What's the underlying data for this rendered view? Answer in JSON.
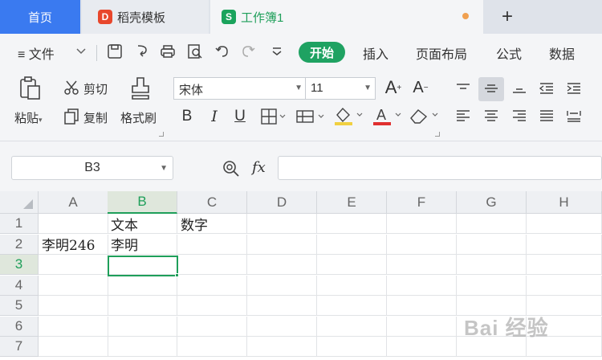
{
  "tabs": {
    "home": "首页",
    "template": "稻壳模板",
    "template_logo": "D",
    "workbook": "工作簿1",
    "workbook_logo": "S",
    "add": "+"
  },
  "menu": {
    "file": "≡ 文件",
    "start": "开始",
    "insert": "插入",
    "page_layout": "页面布局",
    "formula": "公式",
    "data": "数据"
  },
  "ribbon": {
    "paste": "粘贴",
    "cut": "剪切",
    "copy": "复制",
    "format_painter": "格式刷",
    "font_name": "宋体",
    "font_size": "11",
    "bold": "B",
    "italic": "I",
    "underline": "U",
    "font_color": "A"
  },
  "formula_bar": {
    "name_box": "B3",
    "fx": "fx",
    "value": ""
  },
  "grid": {
    "columns": [
      "A",
      "B",
      "C",
      "D",
      "E",
      "F",
      "G",
      "H"
    ],
    "selected_column": "B",
    "rows": [
      "1",
      "2",
      "3",
      "4",
      "5",
      "6",
      "7"
    ],
    "selected_row": "3",
    "cells": {
      "B1": "文本",
      "C1": "数字",
      "A2": "李明246",
      "B2": "李明"
    }
  },
  "watermark": "Bai 经验",
  "colors": {
    "accent_green": "#1f9f5a",
    "home_tab_blue": "#3a7af0"
  }
}
